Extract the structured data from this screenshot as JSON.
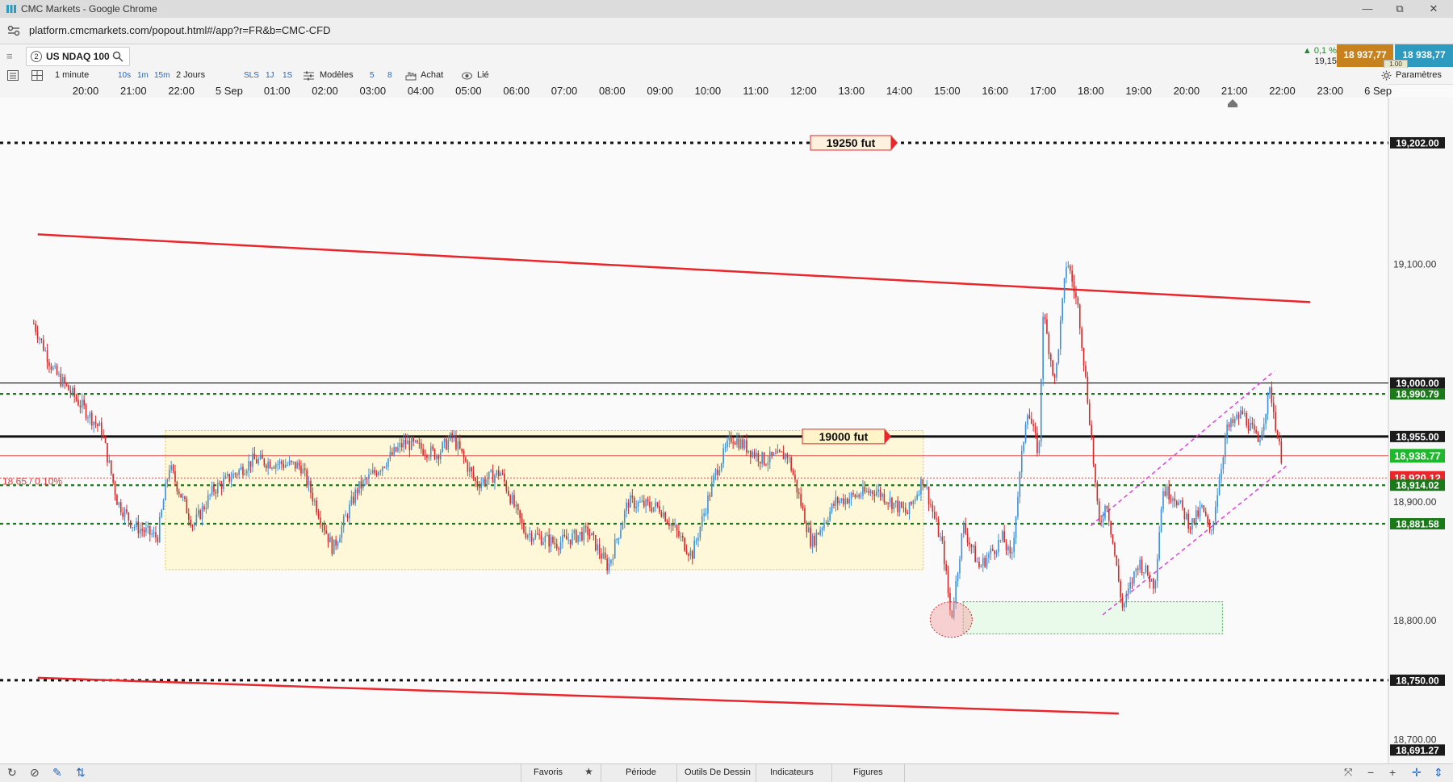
{
  "window": {
    "title": "CMC Markets - Google Chrome",
    "url": "platform.cmcmarkets.com/popout.html#/app?r=FR&b=CMC-CFD",
    "minimize_glyph": "—",
    "restore_glyph": "⧉",
    "close_glyph": "✕"
  },
  "header": {
    "menu_glyph": "≡",
    "instrument_number": "2",
    "instrument_name": "US NDAQ 100",
    "change_percent": "▲ 0,1 %",
    "change_points": "19,15",
    "sell_price": "18 937,77",
    "buy_price": "18 938,77",
    "lot_badge": "1.00"
  },
  "toolbar": {
    "interval": "1 minute",
    "quick_intervals": [
      "10s",
      "1m",
      "15m"
    ],
    "range": "2 Jours",
    "quick_ranges": [
      "SLS",
      "1J",
      "1S"
    ],
    "templates": "Modèles",
    "quick_numbers": [
      "5",
      "8"
    ],
    "buy_label": "Achat",
    "linked_label": "Lié",
    "settings_label": "Paramètres"
  },
  "time_axis": {
    "labels": [
      "20:00",
      "21:00",
      "22:00",
      "5 Sep",
      "01:00",
      "02:00",
      "03:00",
      "04:00",
      "05:00",
      "06:00",
      "07:00",
      "08:00",
      "09:00",
      "10:00",
      "11:00",
      "12:00",
      "13:00",
      "14:00",
      "15:00",
      "16:00",
      "17:00",
      "18:00",
      "19:00",
      "20:00",
      "21:00",
      "22:00",
      "23:00",
      "6 Sep"
    ]
  },
  "bottom_bar": {
    "tabs": [
      "Favoris",
      "Période",
      "Outils De Dessin",
      "Indicateurs",
      "Figures"
    ]
  },
  "colors": {
    "accent_blue": "#2168c4",
    "sell_orange": "#c8821d",
    "buy_blue": "#2d9bc0",
    "trend_red": "#e8262b",
    "level_green": "#1a7a1a",
    "candle_red": "#d12a2a",
    "candle_blue": "#3f8fd6"
  },
  "chart_data": {
    "type": "candlestick",
    "instrument": "US NDAQ 100",
    "interval": "1 minute",
    "y_range": [
      18680,
      19240
    ],
    "y_tick_labels": [
      {
        "label": "19,100.00",
        "value": 19100
      },
      {
        "label": "18,900.00",
        "value": 18900
      },
      {
        "label": "18,800.00",
        "value": 18800
      },
      {
        "label": "18,700.00",
        "value": 18700
      }
    ],
    "price_tags": [
      {
        "label": "19,202.00",
        "value": 19202,
        "style": "dark"
      },
      {
        "label": "19,000.00",
        "value": 19000,
        "style": "dark"
      },
      {
        "label": "18,990.79",
        "value": 18990.79,
        "style": "green"
      },
      {
        "label": "18,955.00",
        "value": 18955,
        "style": "dark"
      },
      {
        "label": "18,938.77",
        "value": 18938.77,
        "style": "buy"
      },
      {
        "label": "18,920.12",
        "value": 18920.12,
        "style": "sell"
      },
      {
        "label": "18,914.02",
        "value": 18914.02,
        "style": "green"
      },
      {
        "label": "18,881.58",
        "value": 18881.58,
        "style": "green"
      },
      {
        "label": "18,750.00",
        "value": 18750,
        "style": "dark"
      },
      {
        "label": "18,691.27",
        "value": 18691.27,
        "style": "dark"
      }
    ],
    "horizontal_levels": [
      {
        "value": 19202,
        "style": "black-dotted"
      },
      {
        "value": 19000,
        "style": "black-thin"
      },
      {
        "value": 18990.79,
        "style": "green-dotted"
      },
      {
        "value": 18955,
        "style": "black-thick"
      },
      {
        "value": 18938.77,
        "style": "red-thin"
      },
      {
        "value": 18920.12,
        "style": "red-dotted-thin"
      },
      {
        "value": 18914.02,
        "style": "green-dotted"
      },
      {
        "value": 18881.58,
        "style": "green-dotted"
      },
      {
        "value": 18750,
        "style": "black-dotted"
      }
    ],
    "level_labels": [
      {
        "text": "19250  fut",
        "value": 19202
      },
      {
        "text": "19000   fut",
        "value": 18955
      }
    ],
    "change_label": "18.65 / 0.10%",
    "trendlines": [
      {
        "color": "red",
        "from": {
          "time": "19:00 (4 Sep)",
          "price": 19125
        },
        "to": {
          "time": "21:35 (5 Sep)",
          "price": 19068
        }
      },
      {
        "color": "red",
        "from": {
          "time": "19:00 (4 Sep)",
          "price": 18752
        },
        "to": {
          "time": "17:35 (5 Sep)",
          "price": 18722
        }
      },
      {
        "color": "magenta",
        "from": {
          "time": "17:00 (5 Sep)",
          "price": 18880
        },
        "to": {
          "time": "20:50 (5 Sep)",
          "price": 19010
        }
      },
      {
        "color": "magenta",
        "from": {
          "time": "17:15 (5 Sep)",
          "price": 18805
        },
        "to": {
          "time": "21:05 (5 Sep)",
          "price": 18930
        }
      }
    ],
    "zones": [
      {
        "color": "yellow",
        "from_time": "21:40 (4 Sep)",
        "to_time": "13:30 (5 Sep)",
        "price_low": 18843,
        "price_high": 18960
      },
      {
        "color": "green",
        "from_time": "14:20 (5 Sep)",
        "to_time": "19:45 (5 Sep)",
        "price_low": 18789,
        "price_high": 18816
      }
    ],
    "marker": {
      "shape": "ellipse",
      "time": "14:05 (5 Sep)",
      "price": 18801
    },
    "price_path": [
      {
        "time": "18:55 (4 Sep)",
        "price": 19050
      },
      {
        "time": "19:20 (4 Sep)",
        "price": 19010
      },
      {
        "time": "19:50 (4 Sep)",
        "price": 18985
      },
      {
        "time": "20:20 (4 Sep)",
        "price": 18960
      },
      {
        "time": "20:40 (4 Sep)",
        "price": 18900
      },
      {
        "time": "21:00 (4 Sep)",
        "price": 18880
      },
      {
        "time": "21:30 (4 Sep)",
        "price": 18870
      },
      {
        "time": "21:45 (4 Sep)",
        "price": 18930
      },
      {
        "time": "22:15 (4 Sep)",
        "price": 18880
      },
      {
        "time": "22:40 (4 Sep)",
        "price": 18910
      },
      {
        "time": "23:30 (4 Sep)",
        "price": 18935
      },
      {
        "time": "00:30 (5 Sep)",
        "price": 18930
      },
      {
        "time": "01:10 (5 Sep)",
        "price": 18860
      },
      {
        "time": "01:40 (5 Sep)",
        "price": 18910
      },
      {
        "time": "02:40 (5 Sep)",
        "price": 18950
      },
      {
        "time": "03:20 (5 Sep)",
        "price": 18940
      },
      {
        "time": "03:40 (5 Sep)",
        "price": 18955
      },
      {
        "time": "04:10 (5 Sep)",
        "price": 18915
      },
      {
        "time": "04:40 (5 Sep)",
        "price": 18925
      },
      {
        "time": "05:10 (5 Sep)",
        "price": 18875
      },
      {
        "time": "05:50 (5 Sep)",
        "price": 18865
      },
      {
        "time": "06:30 (5 Sep)",
        "price": 18875
      },
      {
        "time": "06:55 (5 Sep)",
        "price": 18845
      },
      {
        "time": "07:20 (5 Sep)",
        "price": 18900
      },
      {
        "time": "08:00 (5 Sep)",
        "price": 18895
      },
      {
        "time": "08:40 (5 Sep)",
        "price": 18855
      },
      {
        "time": "09:10 (5 Sep)",
        "price": 18925
      },
      {
        "time": "09:30 (5 Sep)",
        "price": 18955
      },
      {
        "time": "10:10 (5 Sep)",
        "price": 18935
      },
      {
        "time": "10:40 (5 Sep)",
        "price": 18940
      },
      {
        "time": "11:10 (5 Sep)",
        "price": 18865
      },
      {
        "time": "11:40 (5 Sep)",
        "price": 18900
      },
      {
        "time": "12:30 (5 Sep)",
        "price": 18910
      },
      {
        "time": "13:10 (5 Sep)",
        "price": 18890
      },
      {
        "time": "13:30 (5 Sep)",
        "price": 18920
      },
      {
        "time": "13:55 (5 Sep)",
        "price": 18860
      },
      {
        "time": "14:05 (5 Sep)",
        "price": 18800
      },
      {
        "time": "14:20 (5 Sep)",
        "price": 18880
      },
      {
        "time": "14:40 (5 Sep)",
        "price": 18845
      },
      {
        "time": "15:10 (5 Sep)",
        "price": 18870
      },
      {
        "time": "15:20 (5 Sep)",
        "price": 18850
      },
      {
        "time": "15:40 (5 Sep)",
        "price": 18980
      },
      {
        "time": "15:55 (5 Sep)",
        "price": 18940
      },
      {
        "time": "16:00 (5 Sep)",
        "price": 19060
      },
      {
        "time": "16:15 (5 Sep)",
        "price": 19000
      },
      {
        "time": "16:30 (5 Sep)",
        "price": 19105
      },
      {
        "time": "16:45 (5 Sep)",
        "price": 19060
      },
      {
        "time": "17:00 (5 Sep)",
        "price": 18960
      },
      {
        "time": "17:10 (5 Sep)",
        "price": 18880
      },
      {
        "time": "17:20 (5 Sep)",
        "price": 18900
      },
      {
        "time": "17:40 (5 Sep)",
        "price": 18810
      },
      {
        "time": "18:00 (5 Sep)",
        "price": 18850
      },
      {
        "time": "18:20 (5 Sep)",
        "price": 18830
      },
      {
        "time": "18:30 (5 Sep)",
        "price": 18910
      },
      {
        "time": "18:45 (5 Sep)",
        "price": 18905
      },
      {
        "time": "19:05 (5 Sep)",
        "price": 18880
      },
      {
        "time": "19:20 (5 Sep)",
        "price": 18895
      },
      {
        "time": "19:30 (5 Sep)",
        "price": 18870
      },
      {
        "time": "19:50 (5 Sep)",
        "price": 18960
      },
      {
        "time": "20:10 (5 Sep)",
        "price": 18975
      },
      {
        "time": "20:30 (5 Sep)",
        "price": 18950
      },
      {
        "time": "20:45 (5 Sep)",
        "price": 18995
      },
      {
        "time": "20:55 (5 Sep)",
        "price": 18950
      },
      {
        "time": "21:00 (5 Sep)",
        "price": 18935
      }
    ]
  }
}
